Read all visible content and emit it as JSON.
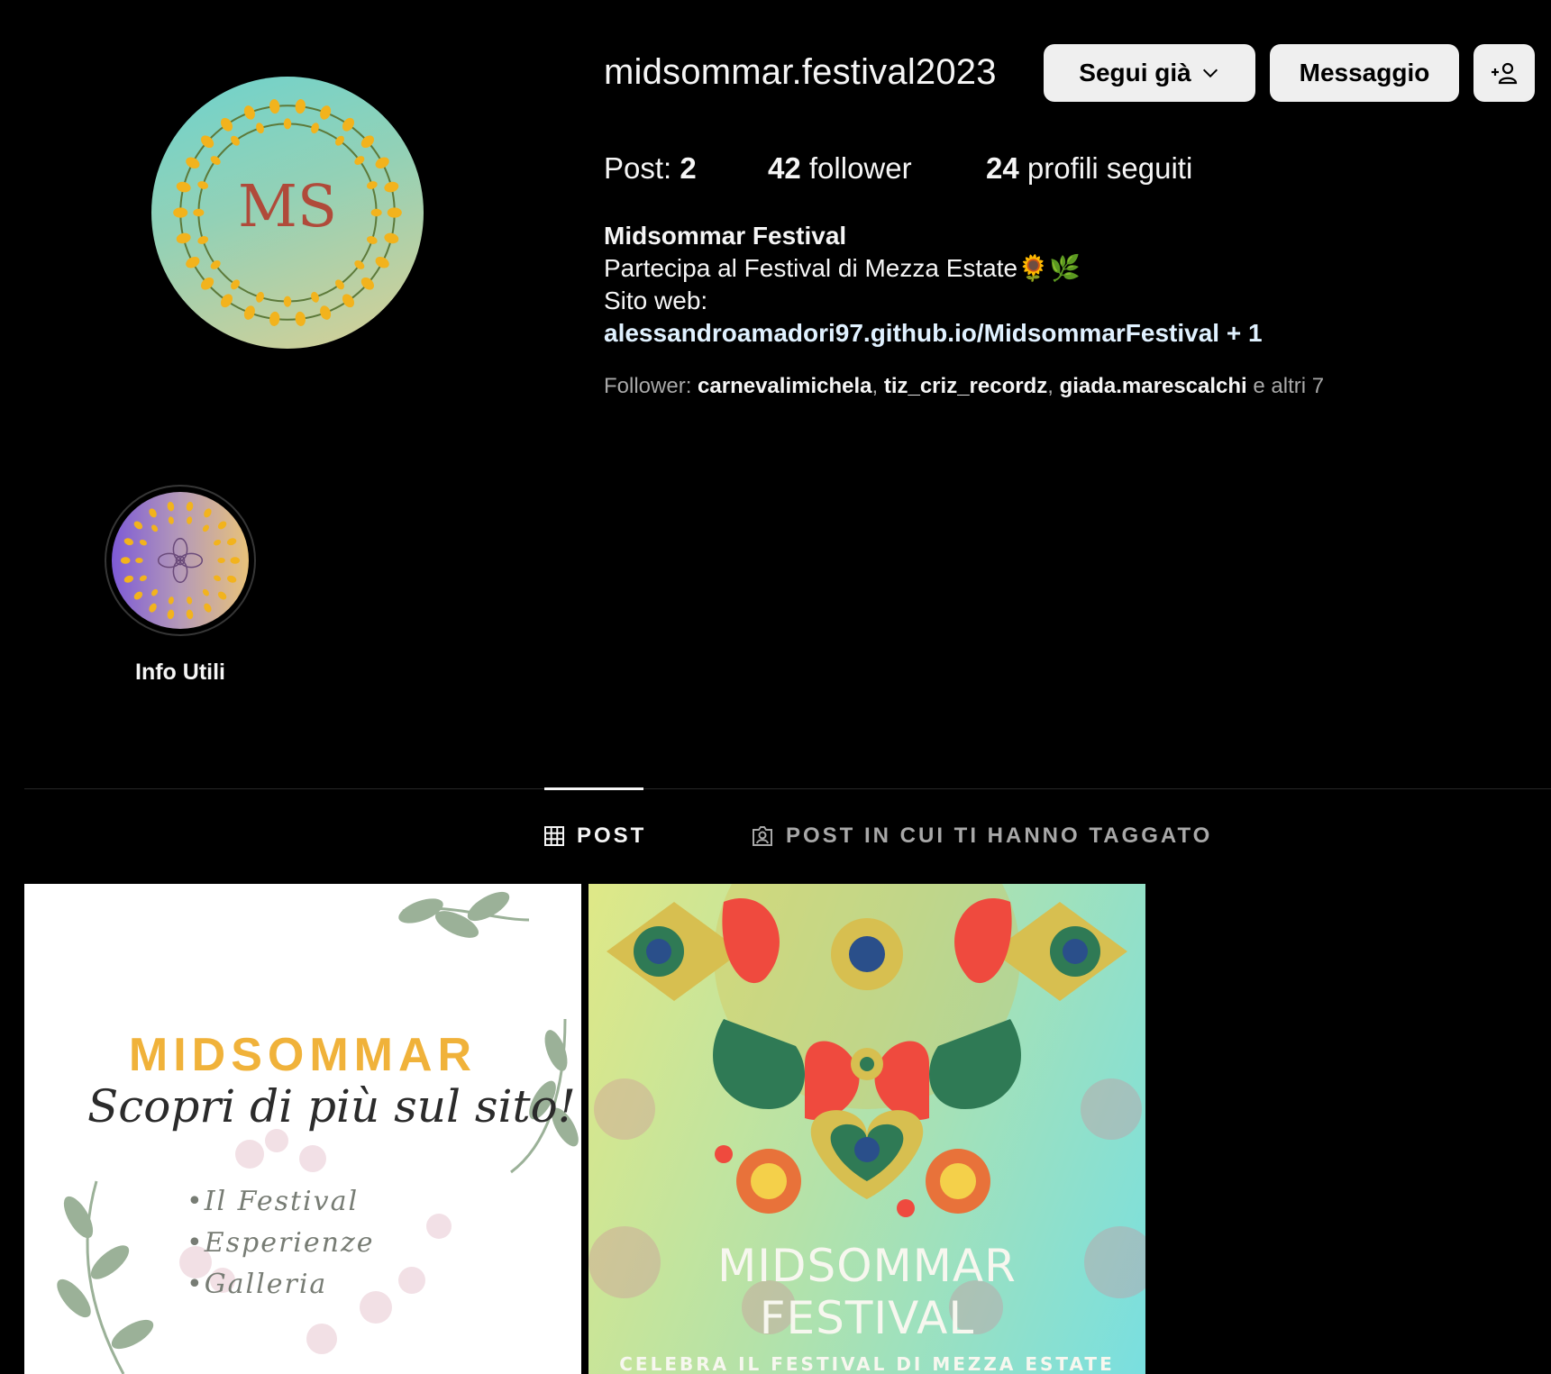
{
  "profile": {
    "username": "midsommar.festival2023",
    "avatar_monogram": "MS"
  },
  "actions": {
    "follow_label": "Segui già",
    "message_label": "Messaggio"
  },
  "stats": {
    "posts_label": "Post:",
    "posts_count": "2",
    "followers_count": "42",
    "followers_label": "follower",
    "following_count": "24",
    "following_label": "profili seguiti"
  },
  "bio": {
    "name": "Midsommar Festival",
    "line1": "Partecipa al Festival di Mezza Estate🌻🌿",
    "line2": "Sito web:",
    "link": "alessandroamadori97.github.io/MidsommarFestival + 1"
  },
  "followed_by": {
    "prefix": "Follower:",
    "users": [
      "carnevalimichela",
      "tiz_criz_recordz",
      "giada.marescalchi"
    ],
    "suffix": "e altri 7"
  },
  "highlights": [
    {
      "label": "Info Utili"
    }
  ],
  "tabs": [
    {
      "label": "POST",
      "icon": "grid-icon",
      "active": true
    },
    {
      "label": "POST IN CUI TI HANNO TAGGATO",
      "icon": "tagged-user-icon",
      "active": false
    }
  ],
  "posts": [
    {
      "title": "MIDSOMMAR",
      "script": "Scopri di più sul sito!",
      "items": [
        "•Il Festival",
        "•Esperienze",
        "•Galleria"
      ]
    },
    {
      "title_line1": "MIDSOMMAR",
      "title_line2": "FESTIVAL",
      "subtitle": "CELEBRA IL FESTIVAL DI MEZZA ESTATE"
    }
  ],
  "colors": {
    "background": "#000000",
    "button_bg": "#efefef",
    "link": "#e0f1ff",
    "muted": "#a8a8a8",
    "post1_title": "#f0b23a"
  }
}
